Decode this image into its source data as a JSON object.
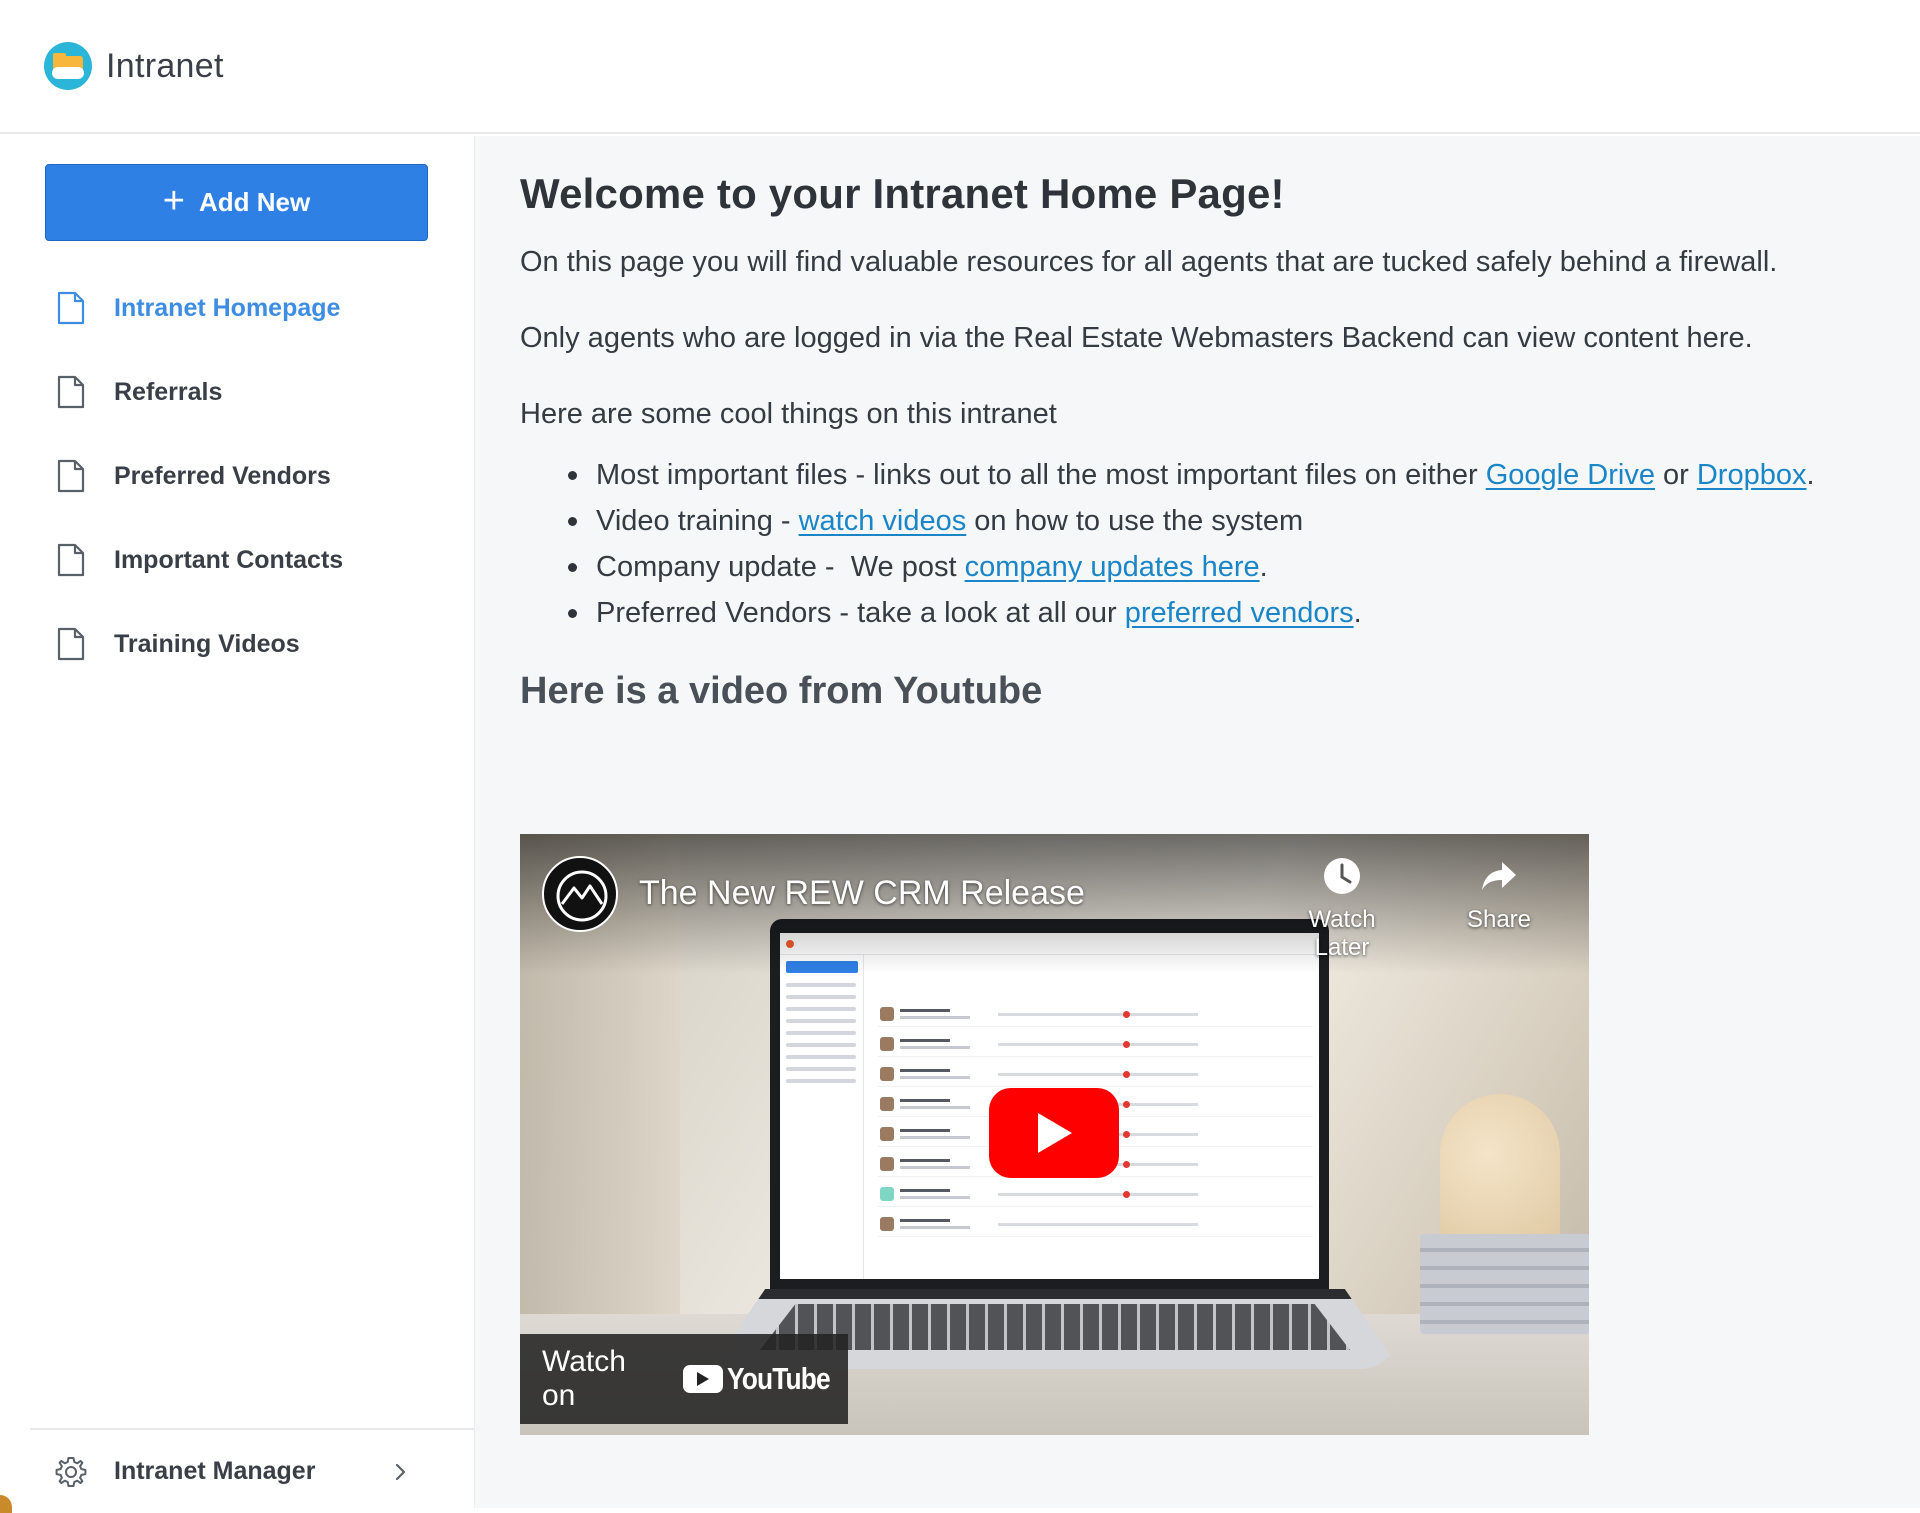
{
  "app": {
    "title": "Intranet"
  },
  "sidebar": {
    "add_button_label": "Add New",
    "items": [
      {
        "label": "Intranet Homepage",
        "active": true
      },
      {
        "label": "Referrals",
        "active": false
      },
      {
        "label": "Preferred Vendors",
        "active": false
      },
      {
        "label": "Important Contacts",
        "active": false
      },
      {
        "label": "Training Videos",
        "active": false
      }
    ],
    "footer_label": "Intranet Manager"
  },
  "main": {
    "heading": "Welcome to your Intranet Home Page!",
    "intro": "On this page you will find valuable resources for all agents that are tucked safely behind a firewall.",
    "notice": "Only agents who are logged in via the Real Estate Webmasters Backend can view content here.",
    "list_intro": "Here are some cool things on this intranet",
    "list": [
      {
        "pre": "Most important files - links out to all the most important files on either ",
        "link1": "Google Drive",
        "mid": " or ",
        "link2": "Dropbox",
        "post": "."
      },
      {
        "pre": "Video training - ",
        "link1": "watch videos",
        "post": " on how to use the system"
      },
      {
        "pre": "Company update -  We post ",
        "link1": "company updates here",
        "post": "."
      },
      {
        "pre": "Preferred Vendors - take a look at all our ",
        "link1": "preferred vendors",
        "post": "."
      }
    ],
    "video_heading": "Here is a video from Youtube"
  },
  "video": {
    "title": "The New REW CRM Release",
    "watch_later": "Watch Later",
    "share": "Share",
    "watch_on": "Watch on",
    "youtube": "YouTube"
  },
  "colors": {
    "accent": "#2f80e4",
    "active_nav": "#3d8de3",
    "link": "#1a86c8",
    "youtube_red": "#ff0000"
  }
}
